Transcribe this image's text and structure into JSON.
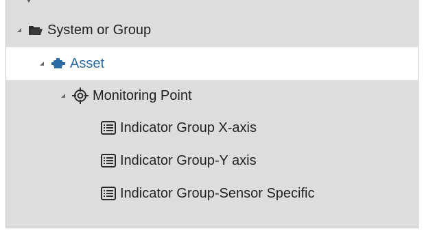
{
  "tree": {
    "system_group": {
      "label": "System or Group",
      "icon": "folder-icon",
      "expanded": true
    },
    "asset": {
      "label": "Asset",
      "icon": "motor-icon",
      "expanded": true,
      "selected": true
    },
    "monitoring_point": {
      "label": "Monitoring Point",
      "icon": "target-icon",
      "expanded": true
    },
    "indicator_groups": [
      {
        "label": "Indicator Group X-axis",
        "icon": "list-icon"
      },
      {
        "label": "Indicator Group-Y axis",
        "icon": "list-icon"
      },
      {
        "label": "Indicator Group-Sensor Specific",
        "icon": "list-icon"
      }
    ]
  },
  "colors": {
    "panel_bg": "#dddddd",
    "selected_bg": "#ffffff",
    "link": "#2c6aa4",
    "text": "#222222"
  }
}
